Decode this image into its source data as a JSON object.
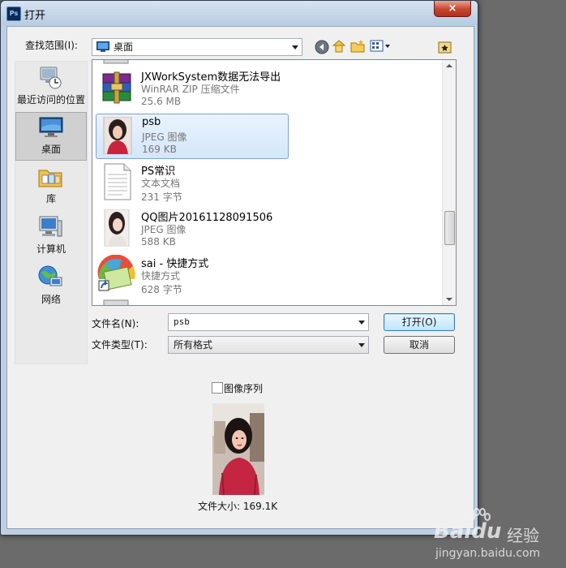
{
  "window": {
    "title": "打开",
    "app_icon": "photoshop-icon",
    "close_label": "×"
  },
  "toolbar": {
    "lookin_label": "查找范围(I):",
    "lookin_value": "桌面",
    "icons": [
      "back-icon",
      "up-folder-icon",
      "new-folder-icon",
      "view-menu-icon"
    ],
    "preview_icon": "preview-toggle-icon"
  },
  "places": [
    {
      "label": "最近访问的位置",
      "icon": "recent-places-icon"
    },
    {
      "label": "桌面",
      "icon": "desktop-icon",
      "selected": true
    },
    {
      "label": "库",
      "icon": "libraries-icon"
    },
    {
      "label": "计算机",
      "icon": "computer-icon"
    },
    {
      "label": "网络",
      "icon": "network-icon"
    }
  ],
  "files": [
    {
      "name": "JXWorkSystem数据无法导出",
      "type": "WinRAR ZIP 压缩文件",
      "size": "25.6 MB",
      "icon": "winrar-archive-icon"
    },
    {
      "name": "psb",
      "type": "JPEG 图像",
      "size": "169 KB",
      "icon": "jpeg-thumbnail-icon",
      "selected": true
    },
    {
      "name": "PS常识",
      "type": "文本文档",
      "size": "231 字节",
      "icon": "text-document-icon"
    },
    {
      "name": "QQ图片20161128091506",
      "type": "JPEG 图像",
      "size": "588 KB",
      "icon": "jpeg-thumbnail-icon"
    },
    {
      "name": "sai - 快捷方式",
      "type": "快捷方式",
      "size": "628 字节",
      "icon": "sai-shortcut-icon"
    }
  ],
  "form": {
    "filename_label": "文件名(N):",
    "filename_value": "psb",
    "filetype_label": "文件类型(T):",
    "filetype_value": "所有格式",
    "open_button": "打开(O)",
    "cancel_button": "取消"
  },
  "preview": {
    "sequence_label": "图像序列",
    "sequence_checked": false,
    "filesize_text": "文件大小: 169.1K"
  },
  "watermark": {
    "brand": "Baidu",
    "brand_cn": "经验",
    "url": "jingyan.baidu.com"
  }
}
